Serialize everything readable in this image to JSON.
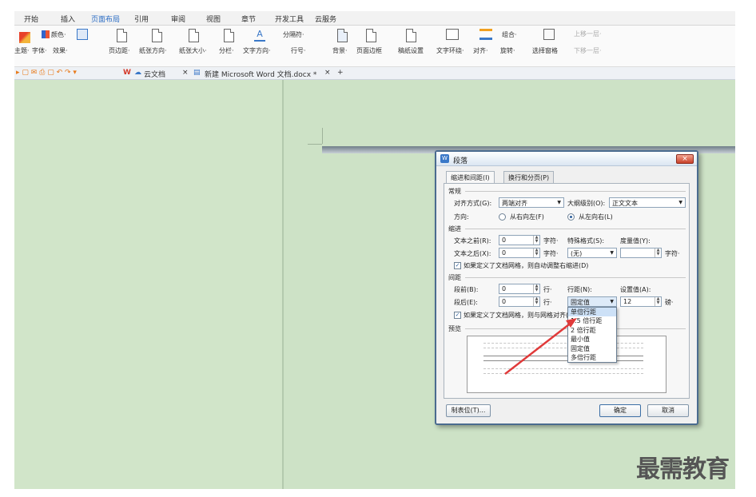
{
  "menubar": {
    "items": [
      "开始",
      "插入",
      "页面布局",
      "引用",
      "审阅",
      "视图",
      "章节",
      "开发工具",
      "云服务"
    ]
  },
  "ribbon": {
    "row1": [
      "颜色·",
      "分隔符·"
    ],
    "row2": [
      "主题·",
      "字体·",
      "效果·",
      "页边距·",
      "纸张方向·",
      "纸张大小·",
      "分栏·",
      "文字方向·",
      "行号·",
      "背景·",
      "页面边框",
      "稿纸设置",
      "文字环绕·",
      "对齐·",
      "旋转·",
      "选择窗格"
    ],
    "group_label": "组合·",
    "dim": [
      "上移一层·",
      "下移一层·"
    ]
  },
  "tabbar": {
    "cloud_doc": "云文档",
    "doc_tab": "新建 Microsoft Word 文档.docx *",
    "close": "×",
    "new": "+"
  },
  "dialog": {
    "title": "段落",
    "close": "×",
    "tabs": [
      "缩进和间距(I)",
      "换行和分页(P)"
    ],
    "general": {
      "section": "常规",
      "align_label": "对齐方式(G):",
      "align_value": "两端对齐",
      "outline_label": "大纲级别(O):",
      "outline_value": "正文文本",
      "dir_label": "方向:",
      "rtl": "从右向左(F)",
      "ltr": "从左向右(L)"
    },
    "indent": {
      "section": "缩进",
      "before_label": "文本之前(R):",
      "before_value": "0",
      "after_label": "文本之后(X):",
      "after_value": "0",
      "unit": "字符·",
      "special_label": "特殊格式(S):",
      "special_value": "(无)",
      "measure_label": "度量值(Y):",
      "auto_adjust": "如果定义了文档网格，则自动调整右缩进(D)"
    },
    "spacing": {
      "section": "间距",
      "before_label": "段前(B):",
      "before_value": "0",
      "after_label": "段后(E):",
      "after_value": "0",
      "unit": "行·",
      "line_label": "行距(N):",
      "line_value": "固定值",
      "set_label": "设置值(A):",
      "set_value": "12",
      "set_unit": "磅·",
      "grid": "如果定义了文档网格，则与网格对齐(W)"
    },
    "preview_label": "预览",
    "line_options": [
      "单倍行距",
      "1.5 倍行距",
      "2 倍行距",
      "最小值",
      "固定值",
      "多倍行距"
    ],
    "tabs_button": "制表位(T)...",
    "ok": "确定",
    "cancel": "取消"
  },
  "watermark": "最需教育",
  "colors": {
    "workspace": "#cde2c6",
    "arrow": "#e03a3a",
    "accent": "#2b6cc4"
  }
}
